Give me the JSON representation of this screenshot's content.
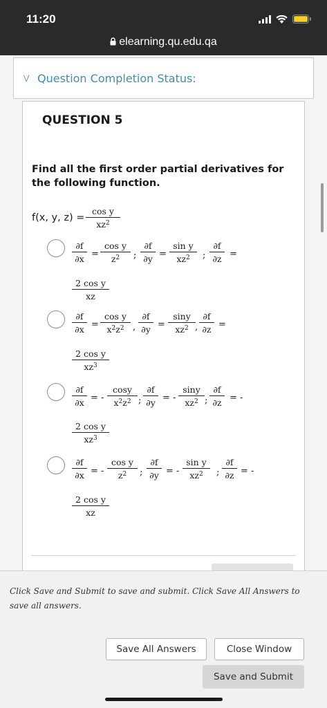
{
  "status_bar": {
    "time": "11:20",
    "icons": [
      "signal-icon",
      "wifi-icon",
      "battery-icon"
    ],
    "battery_color": "#f2d227"
  },
  "browser": {
    "url": "elearning.qu.edu.qa",
    "lock_icon": "lock-icon"
  },
  "completion": {
    "label": "Question Completion Status:",
    "icon": "chevron-down-icon",
    "color": "#3f8fa6"
  },
  "question": {
    "title": "QUESTION 5",
    "prompt": "Find all the first order partial derivatives for the following function.",
    "function": {
      "lhs": "f(x, y, z) =",
      "num": "cos y",
      "den_base": "xz",
      "den_exp": "2"
    }
  },
  "partial": {
    "fx_num": "∂f",
    "fx_den": "∂x",
    "fy_num": "∂f",
    "fy_den": "∂y",
    "fz_num": "∂f",
    "fz_den": "∂z"
  },
  "options": [
    {
      "a_num": "cos y",
      "a_den_base": "z",
      "a_den_exp": "2",
      "eq1": "=",
      "sep1": ";",
      "eq2": "=",
      "b_num": "sin y",
      "b_den_base": "xz",
      "b_den_exp": "2",
      "sep2": ";",
      "eq3": "=",
      "c_num": "2 cos y",
      "c_den_base": "xz",
      "c_den_exp": ""
    },
    {
      "a_num": "cos y",
      "a_den_base": "x",
      "a_den_mid": "z",
      "a_den_exp": "2",
      "eq1": "=",
      "sep1": ",",
      "eq2": "=",
      "b_num": "siny",
      "b_den_base": "xz",
      "b_den_exp": "2",
      "sep2": ",",
      "eq3": "=",
      "c_num": "2 cos y",
      "c_den_base": "xz",
      "c_den_exp": "3"
    },
    {
      "a_num": "cosy",
      "a_den_base": "x",
      "a_den_mid": "z",
      "a_den_exp": "2",
      "eq1": "= -",
      "sep1": ";",
      "eq2": "= -",
      "b_num": "siny",
      "b_den_base": "xz",
      "b_den_exp": "2",
      "sep2": ";",
      "eq3": "= -",
      "c_num": "2 cos y",
      "c_den_base": "xz",
      "c_den_exp": "3"
    },
    {
      "a_num": "cos y",
      "a_den_base": "z",
      "a_den_exp": "2",
      "eq1": "= -",
      "sep1": ";",
      "eq2": "= -",
      "b_num": "sin y",
      "b_den_base": "xz",
      "b_den_exp": "2",
      "sep2": ";",
      "eq3": "= -",
      "c_num": "2 cos y",
      "c_den_base": "xz",
      "c_den_exp": ""
    }
  ],
  "footer": {
    "note": "Click Save and Submit to save and submit. Click Save All Answers to save all answers.",
    "save_all": "Save All Answers",
    "close_window": "Close Window",
    "save_submit": "Save and Submit"
  }
}
